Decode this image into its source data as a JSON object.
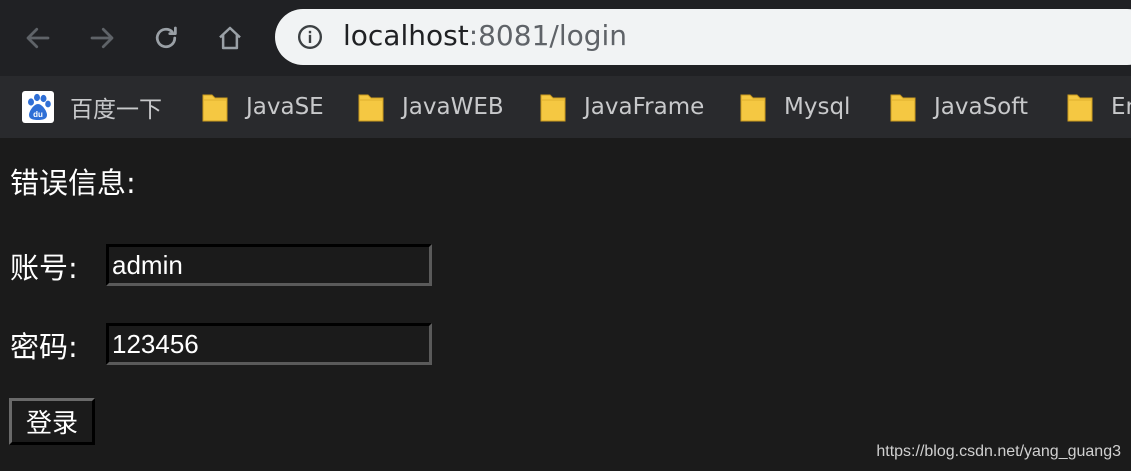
{
  "browser": {
    "url_host": "localhost",
    "url_port_path": ":8081/login",
    "colors": {
      "toolbar": "#202124",
      "bookmarks_bar": "#292a2d",
      "omnibox": "#f1f3f4",
      "page": "#1b1b1b",
      "folder": "#f5c842"
    }
  },
  "bookmarks": [
    {
      "label": "百度一下",
      "icon": "baidu-paw-icon"
    },
    {
      "label": "JavaSE",
      "icon": "folder-icon"
    },
    {
      "label": "JavaWEB",
      "icon": "folder-icon"
    },
    {
      "label": "JavaFrame",
      "icon": "folder-icon"
    },
    {
      "label": "Mysql",
      "icon": "folder-icon"
    },
    {
      "label": "JavaSoft",
      "icon": "folder-icon"
    },
    {
      "label": "En",
      "icon": "folder-icon"
    }
  ],
  "form": {
    "error_label": "错误信息:",
    "account_label": "账号:",
    "account_value": "admin",
    "password_label": "密码:",
    "password_value": "123456",
    "submit_label": "登录"
  },
  "watermark": "https://blog.csdn.net/yang_guang3"
}
